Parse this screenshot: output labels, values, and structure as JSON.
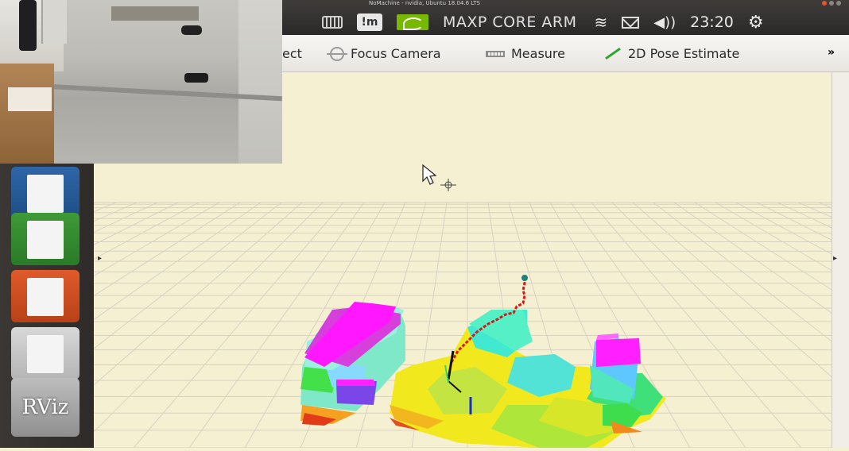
{
  "window": {
    "title": "NoMachine - nvidia, Ubuntu 18.04.6 LTS"
  },
  "top_panel": {
    "device_name": "MAXP CORE ARM",
    "clock": "23:20",
    "nomachine_badge": "!m"
  },
  "toolbar": {
    "select_label": "ect",
    "focus_camera_label": "Focus Camera",
    "measure_label": "Measure",
    "pose_estimate_label": "2D Pose Estimate",
    "more_label": "»"
  },
  "launcher": {
    "rviz_label": "RViz",
    "arrow": "▸"
  },
  "colors": {
    "panel_bg": "#2e2b29",
    "viewport_bg": "#f6f0d3",
    "grid": "#d6d2c2",
    "trajectory": "#d81818",
    "nvidia_green": "#76b900"
  },
  "icons": [
    "keyboard-icon",
    "nvidia-icon",
    "wifi-icon",
    "mail-icon",
    "volume-icon",
    "gear-icon",
    "focus-camera-icon",
    "measure-icon",
    "pose-estimate-icon",
    "cursor-icon",
    "move-icon"
  ]
}
